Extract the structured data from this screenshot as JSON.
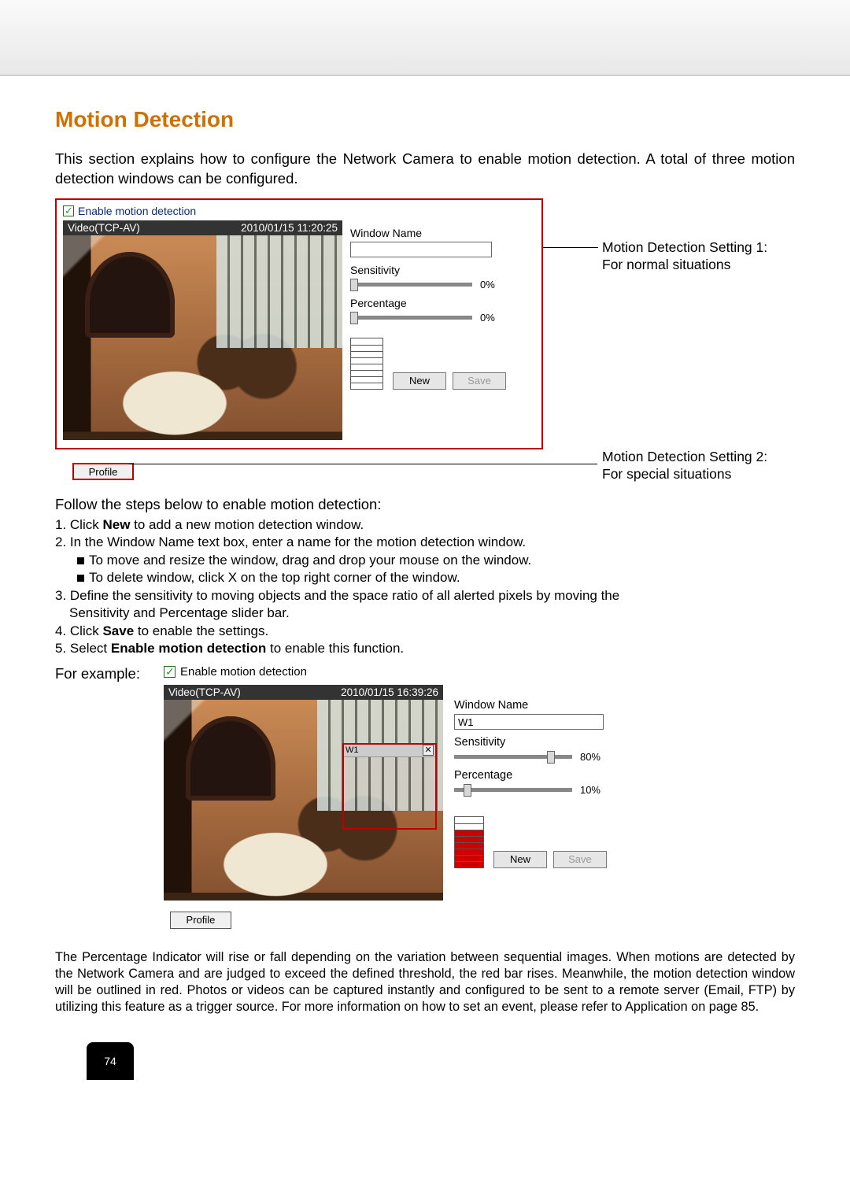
{
  "title": "Motion Detection",
  "intro": "This section explains how to configure the Network Camera to enable motion detection. A total of three motion detection windows can be configured.",
  "panel1": {
    "enable_label": "Enable motion detection",
    "video_source": "Video(TCP-AV)",
    "timestamp": "2010/01/15 11:20:25",
    "window_name_label": "Window Name",
    "window_name_value": "",
    "sensitivity_label": "Sensitivity",
    "sensitivity_value": "0%",
    "percentage_label": "Percentage",
    "percentage_value": "0%",
    "new_btn": "New",
    "save_btn": "Save",
    "profile_btn": "Profile"
  },
  "annotations": {
    "a1_line1": "Motion Detection Setting 1:",
    "a1_line2": "For normal situations",
    "a2_line1": "Motion Detection Setting 2:",
    "a2_line2": "For special situations"
  },
  "follow": "Follow the steps below to enable motion detection:",
  "steps": {
    "s1a": "1. Click ",
    "s1b": "New",
    "s1c": " to add a new motion detection window.",
    "s2": "2. In the Window Name text box, enter a name for the motion detection window.",
    "s2a": "To move and resize the window, drag and drop your mouse on the window.",
    "s2b": "To delete window, click X on the top right corner of the window.",
    "s3": "3. Define the sensitivity to moving objects and the space ratio of all alerted pixels by moving the",
    "s3b": "Sensitivity and Percentage slider bar.",
    "s4a": "4. Click ",
    "s4b": "Save",
    "s4c": " to enable the settings.",
    "s5a": "5. Select ",
    "s5b": "Enable motion detection",
    "s5c": " to enable this function."
  },
  "example_label": "For example:",
  "panel2": {
    "enable_label": "Enable motion detection",
    "video_source": "Video(TCP-AV)",
    "timestamp": "2010/01/15 16:39:26",
    "sel_name": "W1",
    "sel_close": "✕",
    "window_name_label": "Window Name",
    "window_name_value": "W1",
    "sensitivity_label": "Sensitivity",
    "sensitivity_value": "80%",
    "percentage_label": "Percentage",
    "percentage_value": "10%",
    "new_btn": "New",
    "save_btn": "Save",
    "profile_btn": "Profile"
  },
  "body_text": "The Percentage Indicator will rise or fall depending on the variation between sequential images. When motions are detected by the Network Camera and are judged to exceed the defined threshold, the red bar rises. Meanwhile, the motion detection window will be outlined in red. Photos or videos can be captured instantly and configured to be sent to a remote server (Email, FTP) by utilizing this feature as a trigger source. For more information on how to set an event, please refer to Application on page 85.",
  "page_number": "74",
  "chart_data": {
    "type": "bar",
    "note": "Level indicator bars in the two motion-detection panels (top row = highest)",
    "panels": [
      {
        "name": "Setting 1",
        "rows": 8,
        "filled_from_bottom": 0
      },
      {
        "name": "Example (W1)",
        "rows": 8,
        "filled_from_bottom": 6
      }
    ]
  }
}
